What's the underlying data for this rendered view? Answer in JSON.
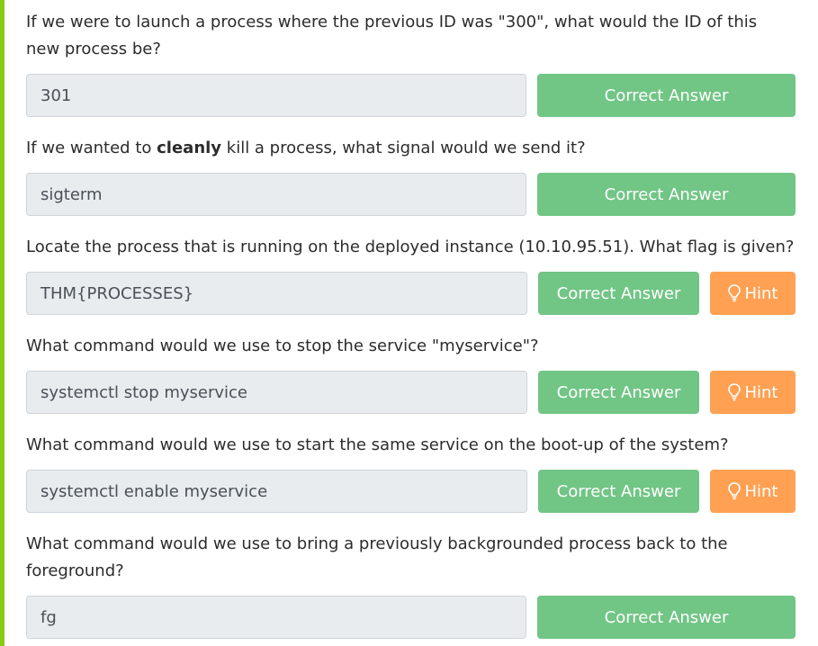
{
  "questions": [
    {
      "text": "If we were to launch a process where the previous ID was \"300\", what would the ID of this new process be?",
      "answer": "301",
      "button": "Correct Answer"
    },
    {
      "text_before": "If we wanted to ",
      "text_bold": "cleanly",
      "text_after": " kill a process, what signal would we send it?",
      "answer": "sigterm",
      "button": "Correct Answer"
    },
    {
      "text": "Locate the process that is running on the deployed instance (10.10.95.51). What flag is given?",
      "answer": "THM{PROCESSES}",
      "button": "Correct Answer",
      "hint": "Hint"
    },
    {
      "text": "What command would we use to stop the service \"myservice\"?",
      "answer": "systemctl stop myservice",
      "button": "Correct Answer",
      "hint": "Hint"
    },
    {
      "text": "What command would we use to start the same service on the boot-up of the system?",
      "answer": "systemctl enable myservice",
      "button": "Correct Answer",
      "hint": "Hint"
    },
    {
      "text": "What command would we use to bring a previously backgrounded process back to the foreground?",
      "answer": "fg",
      "button": "Correct Answer"
    }
  ],
  "colors": {
    "accent": "#88cc14",
    "correct": "#71c585",
    "hint": "#ffa052",
    "input_bg": "#e9ecef"
  },
  "icons": {
    "hint": "lightbulb-icon"
  }
}
